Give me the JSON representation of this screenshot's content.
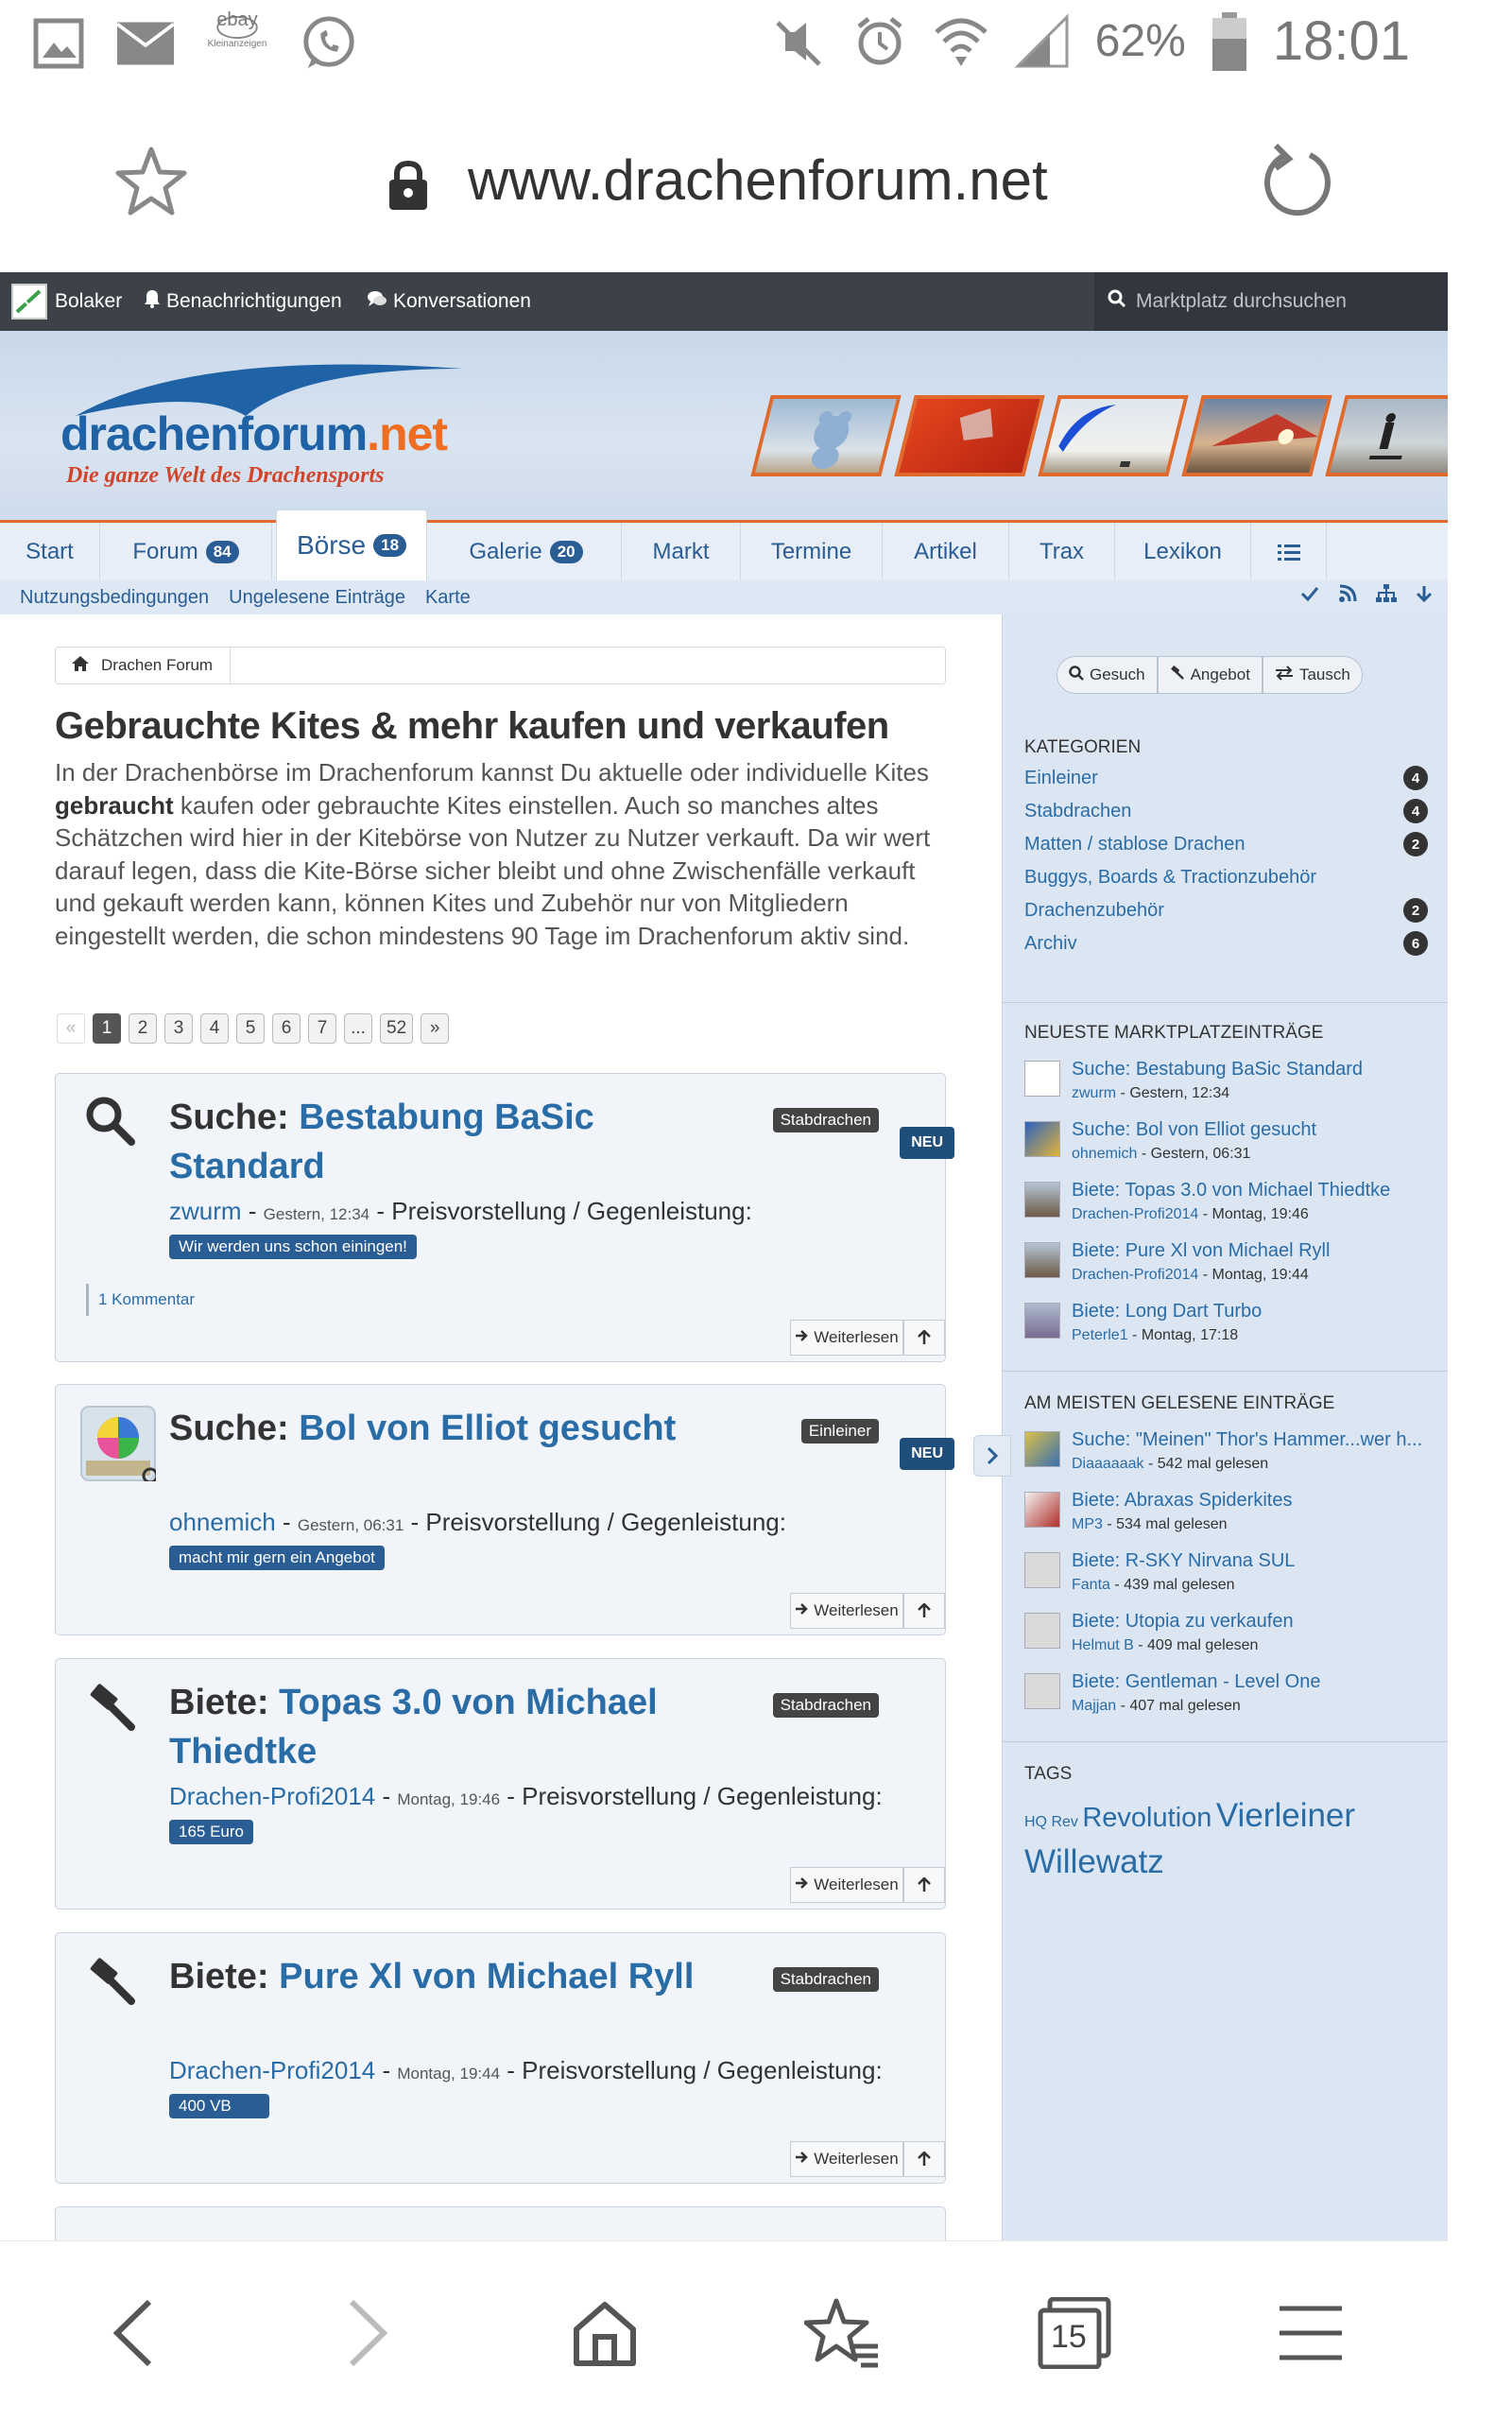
{
  "status_bar": {
    "battery": "62%",
    "time": "18:01",
    "icons": [
      "gallery-icon",
      "mail-icon",
      "ebay-kleinanzeigen-icon",
      "whatsapp-icon",
      "mute-icon",
      "alarm-icon",
      "wifi-icon",
      "signal-icon",
      "battery-icon"
    ],
    "ebay_text": "ebay",
    "ebay_sub": "Kleinanzeigen"
  },
  "browser": {
    "url": "www.drachenforum.net",
    "tab_count": "15"
  },
  "topbar": {
    "user": "Bolaker",
    "notifications": "Benachrichtigungen",
    "conversations": "Konversationen",
    "search_placeholder": "Marktplatz durchsuchen"
  },
  "logo": {
    "name_main": "drachenforum",
    "name_tld": ".net",
    "tagline": "Die ganze Welt des Drachensports"
  },
  "nav": {
    "tabs": [
      {
        "label": "Start",
        "badge": ""
      },
      {
        "label": "Forum",
        "badge": "84"
      },
      {
        "label": "Börse",
        "badge": "18"
      },
      {
        "label": "Galerie",
        "badge": "20"
      },
      {
        "label": "Markt",
        "badge": ""
      },
      {
        "label": "Termine",
        "badge": ""
      },
      {
        "label": "Artikel",
        "badge": ""
      },
      {
        "label": "Trax",
        "badge": ""
      },
      {
        "label": "Lexikon",
        "badge": ""
      }
    ],
    "subnav": [
      "Nutzungsbedingungen",
      "Ungelesene Einträge",
      "Karte"
    ]
  },
  "breadcrumb": {
    "home": "Drachen Forum"
  },
  "page": {
    "title": "Gebrauchte Kites & mehr kaufen und verkaufen",
    "intro_1": "In der Drachenbörse im Drachenforum kannst Du aktuelle oder individuelle Kites ",
    "intro_bold": "gebraucht",
    "intro_2": " kaufen oder gebrauchte Kites einstellen. Auch so manches altes Schätzchen wird hier in der Kitebörse von Nutzer zu Nutzer verkauft. Da wir wert darauf legen, dass die Kite-Börse sicher bleibt und ohne Zwischenfälle verkauft und gekauft werden kann, können Kites und Zubehör nur von Mitgliedern eingestellt werden, die schon mindestens 90 Tage im Drachenforum aktiv sind."
  },
  "pager": {
    "prev": "«",
    "pages": [
      "1",
      "2",
      "3",
      "4",
      "5",
      "6",
      "7",
      "...",
      "52"
    ],
    "next": "»"
  },
  "listings": [
    {
      "type": "Suche:",
      "title": "Bestabung BaSic Standard",
      "category": "Stabdrachen",
      "new": "NEU",
      "user": "zwurm",
      "date": "Gestern, 12:34",
      "price_label": "Preisvorstellung / Gegenleistung:",
      "price": "Wir werden uns schon einingen!",
      "comment": "1 Kommentar",
      "more": "Weiterlesen"
    },
    {
      "type": "Suche:",
      "title": "Bol von Elliot gesucht",
      "category": "Einleiner",
      "new": "NEU",
      "user": "ohnemich",
      "date": "Gestern, 06:31",
      "price_label": "Preisvorstellung / Gegenleistung:",
      "price": "macht mir gern ein Angebot",
      "more": "Weiterlesen"
    },
    {
      "type": "Biete:",
      "title": "Topas 3.0 von Michael Thiedtke",
      "category": "Stabdrachen",
      "user": "Drachen-Profi2014",
      "date": "Montag, 19:46",
      "price_label": "Preisvorstellung / Gegenleistung:",
      "price": "165 Euro",
      "more": "Weiterlesen"
    },
    {
      "type": "Biete:",
      "title": "Pure Xl von Michael Ryll",
      "category": "Stabdrachen",
      "user": "Drachen-Profi2014",
      "date": "Montag, 19:44",
      "price_label": "Preisvorstellung / Gegenleistung:",
      "price": "400 VB",
      "more": "Weiterlesen"
    }
  ],
  "sidebar": {
    "buttons": [
      "Gesuch",
      "Angebot",
      "Tausch"
    ],
    "categories_title": "Kategorien",
    "categories": [
      {
        "name": "Einleiner",
        "count": "4"
      },
      {
        "name": "Stabdrachen",
        "count": "4"
      },
      {
        "name": "Matten / stablose Drachen",
        "count": "2"
      },
      {
        "name": "Buggys, Boards & Tractionzubehör",
        "count": ""
      },
      {
        "name": "Drachenzubehör",
        "count": "2"
      },
      {
        "name": "Archiv",
        "count": "6"
      }
    ],
    "newest_title": "Neueste Marktplatzeinträge",
    "newest": [
      {
        "title": "Suche: Bestabung BaSic Standard",
        "user": "zwurm",
        "meta": " - Gestern, 12:34"
      },
      {
        "title": "Suche: Bol von Elliot gesucht",
        "user": "ohnemich",
        "meta": " - Gestern, 06:31"
      },
      {
        "title": "Biete: Topas 3.0 von Michael Thiedtke",
        "user": "Drachen-Profi2014",
        "meta": " - Montag, 19:46"
      },
      {
        "title": "Biete: Pure Xl von Michael Ryll",
        "user": "Drachen-Profi2014",
        "meta": " - Montag, 19:44"
      },
      {
        "title": "Biete: Long Dart Turbo",
        "user": "Peterle1",
        "meta": " - Montag, 17:18"
      }
    ],
    "most_read_title": "Am meisten gelesene Einträge",
    "most_read": [
      {
        "title": "Suche: \"Meinen\" Thor's Hammer...wer h...",
        "user": "Diaaaaaak",
        "meta": " - 542 mal gelesen"
      },
      {
        "title": "Biete: Abraxas Spiderkites",
        "user": "MP3",
        "meta": " - 534 mal gelesen"
      },
      {
        "title": "Biete: R-SKY Nirvana SUL",
        "user": "Fanta",
        "meta": " - 439 mal gelesen"
      },
      {
        "title": "Biete: Utopia zu verkaufen",
        "user": "Helmut B",
        "meta": " - 409 mal gelesen"
      },
      {
        "title": "Biete: Gentleman - Level One",
        "user": "Majjan",
        "meta": " - 407 mal gelesen"
      }
    ],
    "tags_title": "Tags",
    "tags": [
      "HQ",
      "Rev",
      "Revolution",
      "Vierleiner",
      "Willewatz"
    ]
  },
  "colors": {
    "accent_blue": "#2a6ca6",
    "nav_orange": "#e06a2c",
    "topbar_dark": "#3d4249",
    "sidebar_bg": "#dce6f3"
  }
}
